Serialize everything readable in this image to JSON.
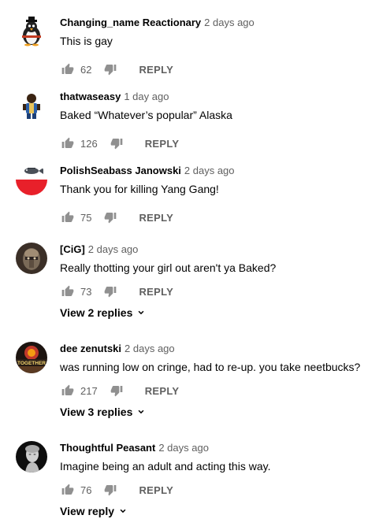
{
  "comments": [
    {
      "author": "Changing_name Reactionary",
      "time": "2 days ago",
      "text": "This is gay",
      "likes": "62",
      "reply_label": "REPLY",
      "avatar_icon": "penguin-avatar"
    },
    {
      "author": "thatwaseasy",
      "time": "1 day ago",
      "text": "Baked “Whatever’s popular” Alaska",
      "likes": "126",
      "reply_label": "REPLY",
      "avatar_icon": "character-avatar"
    },
    {
      "author": "PolishSeabass Janowski",
      "time": "2 days ago",
      "text": "Thank you for killing Yang Gang!",
      "likes": "75",
      "reply_label": "REPLY",
      "avatar_icon": "fish-flag-avatar"
    },
    {
      "author": "[CiG]",
      "time": "2 days ago",
      "text": "Really thotting your girl out aren't ya Baked?",
      "likes": "73",
      "reply_label": "REPLY",
      "view_replies": "View 2 replies",
      "avatar_icon": "helmet-avatar"
    },
    {
      "author": "dee zenutski",
      "time": "2 days ago",
      "text": "was running low on cringe, had to re-up. you take neetbucks?",
      "likes": "217",
      "reply_label": "REPLY",
      "view_replies": "View 3 replies",
      "avatar_icon": "together-avatar",
      "avatar_text": "TOGETHER"
    },
    {
      "author": "Thoughtful Peasant",
      "time": "2 days ago",
      "text": "Imagine being an adult and acting this way.",
      "likes": "76",
      "reply_label": "REPLY",
      "view_replies": "View reply",
      "avatar_icon": "statue-avatar"
    }
  ],
  "colors": {
    "text": "#030303",
    "secondary": "#606060",
    "icon": "#909090"
  }
}
